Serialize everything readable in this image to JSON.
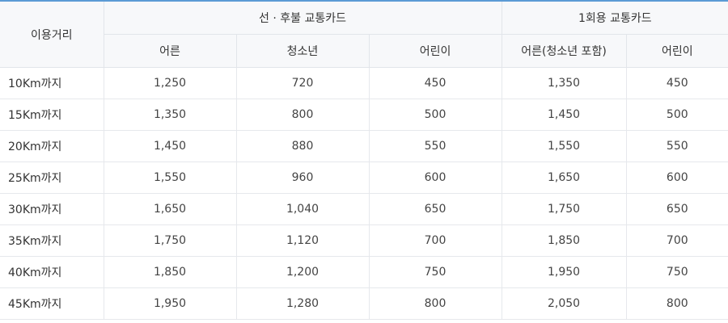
{
  "header": {
    "distance": "이용거리",
    "group1": "선 · 후불 교통카드",
    "group2": "1회용 교통카드",
    "g1_adult": "어른",
    "g1_youth": "청소년",
    "g1_child": "어린이",
    "g2_adult": "어른(청소년 포함)",
    "g2_child": "어린이"
  },
  "rows": [
    {
      "distance": "10Km까지",
      "c1": "1,250",
      "c2": "720",
      "c3": "450",
      "c4": "1,350",
      "c5": "450"
    },
    {
      "distance": "15Km까지",
      "c1": "1,350",
      "c2": "800",
      "c3": "500",
      "c4": "1,450",
      "c5": "500"
    },
    {
      "distance": "20Km까지",
      "c1": "1,450",
      "c2": "880",
      "c3": "550",
      "c4": "1,550",
      "c5": "550"
    },
    {
      "distance": "25Km까지",
      "c1": "1,550",
      "c2": "960",
      "c3": "600",
      "c4": "1,650",
      "c5": "600"
    },
    {
      "distance": "30Km까지",
      "c1": "1,650",
      "c2": "1,040",
      "c3": "650",
      "c4": "1,750",
      "c5": "650"
    },
    {
      "distance": "35Km까지",
      "c1": "1,750",
      "c2": "1,120",
      "c3": "700",
      "c4": "1,850",
      "c5": "700"
    },
    {
      "distance": "40Km까지",
      "c1": "1,850",
      "c2": "1,200",
      "c3": "750",
      "c4": "1,950",
      "c5": "750"
    },
    {
      "distance": "45Km까지",
      "c1": "1,950",
      "c2": "1,280",
      "c3": "800",
      "c4": "2,050",
      "c5": "800"
    }
  ],
  "colors": {
    "top_border": "#5b9bd5",
    "header_bg": "#f7f8fa",
    "grid": "#e2e5ea"
  }
}
